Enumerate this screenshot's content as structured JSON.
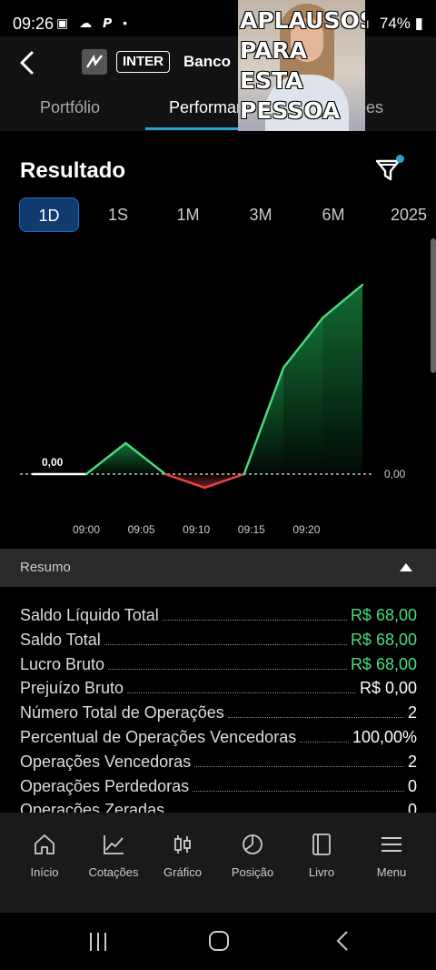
{
  "status_bar": {
    "time": "09:26",
    "left_icons": "▣ ☁ 𝙋 •",
    "battery": "74%",
    "signal_icons": "ıll"
  },
  "header": {
    "ticker": "INTER",
    "name": "Banco"
  },
  "meme": {
    "caption_line1": "APLAUSOS",
    "caption_line2": "PARA ESTA",
    "caption_line3": "PESSOA"
  },
  "tabs": [
    {
      "label": "Portfólio"
    },
    {
      "label": "Performance"
    },
    {
      "label": "Cotações"
    }
  ],
  "result": {
    "title": "Resultado"
  },
  "periods": [
    "1D",
    "1S",
    "1M",
    "3M",
    "6M",
    "2025"
  ],
  "colors": {
    "accent": "#2aa3c9",
    "positive": "#4ade80",
    "negative": "#ef4444",
    "selected_period_bg": "#0f3b6e"
  },
  "chart_data": {
    "type": "line",
    "x": [
      "09:00",
      "09:02",
      "09:05",
      "09:08",
      "09:10",
      "09:13",
      "09:16",
      "09:19",
      "09:22"
    ],
    "values": [
      0,
      0,
      34,
      0,
      -15,
      0,
      117,
      172,
      208
    ],
    "x_ticks": [
      "09:00",
      "09:05",
      "09:10",
      "09:15",
      "09:20"
    ],
    "start_label": "0,00",
    "baseline_label": "0,00",
    "baseline": 0,
    "grid": false
  },
  "summary": {
    "title": "Resumo",
    "rows": [
      {
        "label": "Saldo Líquido Total",
        "value": "R$ 68,00",
        "positive": true
      },
      {
        "label": "Saldo Total",
        "value": "R$ 68,00",
        "positive": true
      },
      {
        "label": "Lucro Bruto",
        "value": "R$ 68,00",
        "positive": true
      },
      {
        "label": "Prejuízo Bruto",
        "value": "R$ 0,00",
        "positive": false
      },
      {
        "label": "Número Total de Operações",
        "value": "2",
        "positive": false
      },
      {
        "label": "Percentual de Operações Vencedoras",
        "value": "100,00%",
        "positive": false
      },
      {
        "label": "Operações Vencedoras",
        "value": "2",
        "positive": false
      },
      {
        "label": "Operações Perdedoras",
        "value": "0",
        "positive": false
      },
      {
        "label": "Operações Zeradas",
        "value": "0",
        "positive": false
      }
    ]
  },
  "bottom_nav": [
    {
      "label": "Início",
      "icon": "home-icon"
    },
    {
      "label": "Cotações",
      "icon": "chart-line-icon"
    },
    {
      "label": "Gráfico",
      "icon": "candlestick-icon"
    },
    {
      "label": "Posição",
      "icon": "pie-chart-icon"
    },
    {
      "label": "Livro",
      "icon": "book-icon"
    },
    {
      "label": "Menu",
      "icon": "menu-icon"
    }
  ]
}
